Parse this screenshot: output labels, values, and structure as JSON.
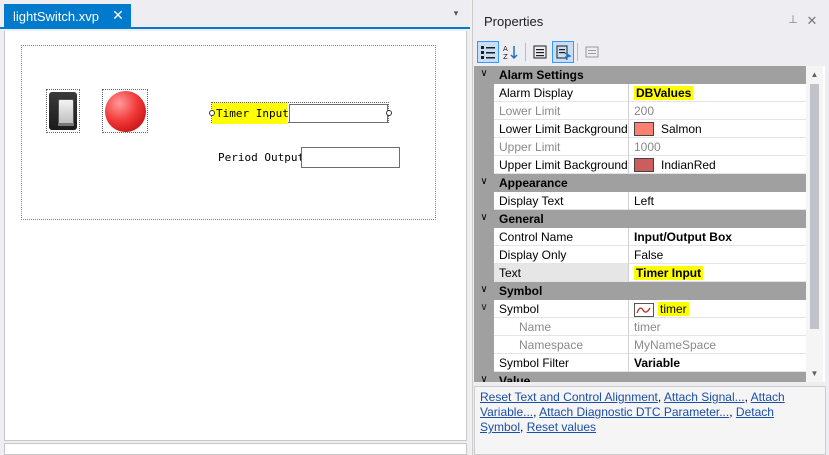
{
  "document": {
    "tab_title": "lightSwitch.xvp",
    "tab_close_glyph": "✕",
    "overflow_glyph": "▾",
    "controls": {
      "timer_label": "Timer Input",
      "period_label": "Period Output"
    }
  },
  "properties": {
    "title": "Properties",
    "pin_glyph": "⊥",
    "close_glyph": "✕",
    "toolbar_icons": [
      "categorized-icon",
      "alphabetical-icon",
      "properties-icon",
      "events-icon",
      "property-pages-icon"
    ],
    "categories": {
      "alarm": "Alarm Settings",
      "appearance": "Appearance",
      "general": "General",
      "symbol": "Symbol",
      "value": "Value"
    },
    "rows": {
      "alarm_display": {
        "name": "Alarm Display",
        "value": "DBValues"
      },
      "lower_limit": {
        "name": "Lower Limit",
        "value": "200"
      },
      "lower_limit_bg": {
        "name": "Lower Limit Background",
        "value": "Salmon",
        "color": "#fa8072"
      },
      "upper_limit": {
        "name": "Upper Limit",
        "value": "1000"
      },
      "upper_limit_bg": {
        "name": "Upper Limit Background",
        "value": "IndianRed",
        "color": "#cd5c5c"
      },
      "display_text": {
        "name": "Display Text",
        "value": "Left"
      },
      "control_name": {
        "name": "Control Name",
        "value": "Input/Output Box"
      },
      "display_only": {
        "name": "Display Only",
        "value": "False"
      },
      "text": {
        "name": "Text",
        "value": "Timer Input"
      },
      "symbol": {
        "name": "Symbol",
        "value": "timer"
      },
      "sym_name": {
        "name": "Name",
        "value": "timer"
      },
      "sym_namespace": {
        "name": "Namespace",
        "value": "MyNameSpace"
      },
      "symbol_filter": {
        "name": "Symbol Filter",
        "value": "Variable"
      }
    },
    "commands": {
      "reset_text": "Reset Text and Control Alignment",
      "attach_signal": "Attach Signal...",
      "attach_variable": "Attach Variable...",
      "attach_dtc": "Attach Diagnostic DTC Parameter...",
      "detach_symbol": "Detach Symbol",
      "reset_values": "Reset values"
    }
  },
  "colors": {
    "accent": "#007acc",
    "highlight": "#ffff00",
    "category_bg": "#a0a0a0",
    "link": "#1a4ea8"
  }
}
